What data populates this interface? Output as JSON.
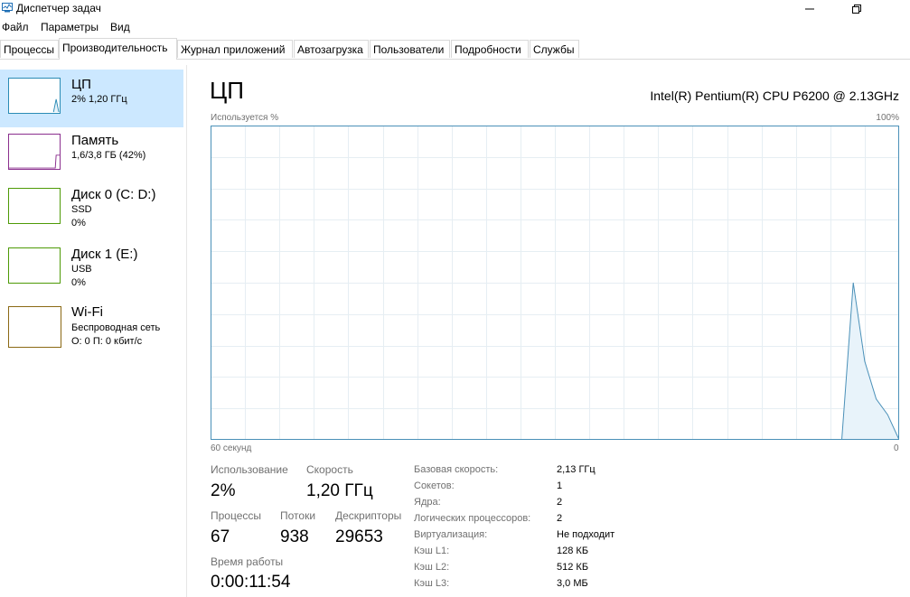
{
  "window": {
    "title": "Диспетчер задач"
  },
  "menu": [
    "Файл",
    "Параметры",
    "Вид"
  ],
  "tabs": [
    "Процессы",
    "Производительность",
    "Журнал приложений",
    "Автозагрузка",
    "Пользователи",
    "Подробности",
    "Службы"
  ],
  "active_tab": "Производительность",
  "sidebar": {
    "items": [
      {
        "title": "ЦП",
        "sub1": "2% 1,20 ГГц",
        "sub2": "",
        "color": "#2a8bb5",
        "selected": true
      },
      {
        "title": "Память",
        "sub1": "1,6/3,8 ГБ (42%)",
        "sub2": "",
        "color": "#8b2f8e",
        "selected": false
      },
      {
        "title": "Диск 0 (C: D:)",
        "sub1": "SSD",
        "sub2": "0%",
        "color": "#4e9a06",
        "selected": false
      },
      {
        "title": "Диск 1 (E:)",
        "sub1": "USB",
        "sub2": "0%",
        "color": "#4e9a06",
        "selected": false
      },
      {
        "title": "Wi-Fi",
        "sub1": "Беспроводная сеть",
        "sub2": "О: 0 П: 0 кбит/с",
        "color": "#8b6914",
        "selected": false
      }
    ]
  },
  "main": {
    "title": "ЦП",
    "cpu_name": "Intel(R) Pentium(R) CPU P6200 @ 2.13GHz",
    "y_label": "Используется %",
    "y_max": "100%",
    "x_label": "60 секунд",
    "x_min": "0"
  },
  "chart_data": {
    "type": "area",
    "x": [
      60,
      5,
      4,
      3,
      2,
      1,
      0
    ],
    "values": [
      0,
      0,
      50,
      25,
      13,
      8,
      0
    ],
    "xlim": [
      60,
      0
    ],
    "ylim": [
      0,
      100
    ],
    "grid": true,
    "color": "#4a90b8",
    "fill": "#e8f3fa"
  },
  "stats": {
    "usage_label": "Использование",
    "usage_value": "2%",
    "speed_label": "Скорость",
    "speed_value": "1,20 ГГц",
    "processes_label": "Процессы",
    "processes_value": "67",
    "threads_label": "Потоки",
    "threads_value": "938",
    "handles_label": "Дескрипторы",
    "handles_value": "29653",
    "uptime_label": "Время работы",
    "uptime_value": "0:00:11:54"
  },
  "specs": [
    {
      "label": "Базовая скорость:",
      "value": "2,13 ГГц"
    },
    {
      "label": "Сокетов:",
      "value": "1"
    },
    {
      "label": "Ядра:",
      "value": "2"
    },
    {
      "label": "Логических процессоров:",
      "value": "2"
    },
    {
      "label": "Виртуализация:",
      "value": "Не подходит"
    },
    {
      "label": "Кэш L1:",
      "value": "128 КБ"
    },
    {
      "label": "Кэш L2:",
      "value": "512 КБ"
    },
    {
      "label": "Кэш L3:",
      "value": "3,0 МБ"
    }
  ]
}
